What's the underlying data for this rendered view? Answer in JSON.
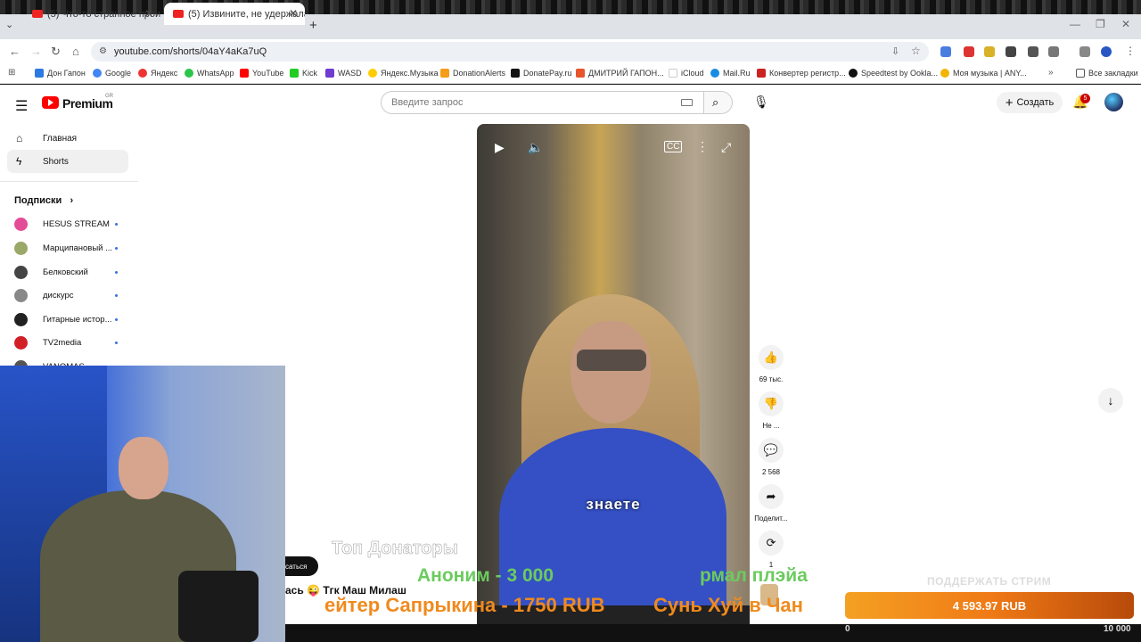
{
  "browser": {
    "tabs": [
      {
        "title": "(5) Что-то странное происход"
      },
      {
        "title": "(5) Извините, не удержалась"
      }
    ],
    "url": "youtube.com/shorts/04aY4aKa7uQ",
    "bookmarks": [
      "Дон Гапон",
      "Google",
      "Яндекс",
      "WhatsApp",
      "YouTube",
      "Kick",
      "WASD",
      "Яндекс.Музыка",
      "DonationAlerts",
      "DonatePay.ru",
      "ДМИТРИЙ ГАПОН...",
      "iCloud",
      "Mail.Ru",
      "Конвертер регистр...",
      "Speedtest by Ookla...",
      "Моя музыка | ANY...",
      "Все закладки"
    ]
  },
  "youtube": {
    "brand": "Premium",
    "region": "GR",
    "search_placeholder": "Введите запрос",
    "create_label": "Создать",
    "notifications": "5",
    "sidebar": {
      "home": "Главная",
      "shorts": "Shorts",
      "subscriptions_title": "Подписки",
      "subscriptions": [
        "HESUS STREAM",
        "Марципановый ...",
        "Белковский",
        "дискурс",
        "Гитарные истор...",
        "TV2media",
        "VANOMAS"
      ]
    },
    "video": {
      "caption": "знаете"
    },
    "actions": {
      "likes": "69 тыс.",
      "dislike": "Не ...",
      "comments": "2 568",
      "share": "Поделит...",
      "remix": "1"
    }
  },
  "overlay": {
    "top_donators": "Топ Донаторы",
    "donor1": "Аноним - 3 000",
    "donor2": "рмал плэйа",
    "donor3": "ейтер Сапрыкина - 1750 RUB",
    "donor4": "Сунь Хуй в Чан",
    "subscribe_fragment": "саться",
    "ticker": "ась 😜 Тгк Маш Милаш",
    "support_title": "ПОДДЕРЖАТЬ СТРИМ",
    "support_amount": "4 593.97 RUB",
    "goal_start": "0",
    "goal_end": "10 000"
  }
}
